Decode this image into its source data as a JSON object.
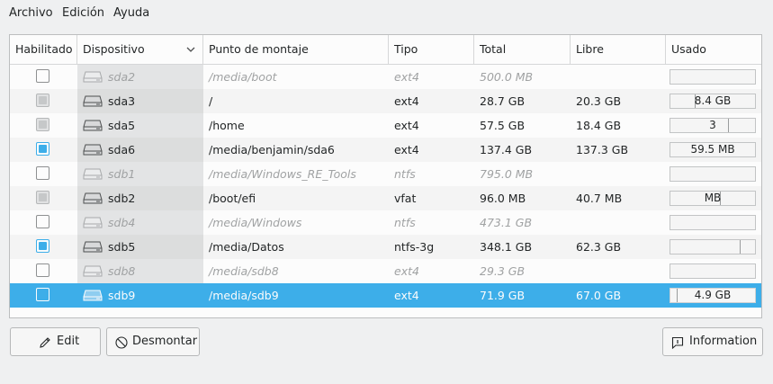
{
  "menu": {
    "archivo": "Archivo",
    "edicion": "Edición",
    "ayuda": "Ayuda"
  },
  "table": {
    "headers": {
      "habilitado": "Habilitado",
      "dispositivo": "Dispositivo",
      "punto": "Punto de montaje",
      "tipo": "Tipo",
      "total": "Total",
      "libre": "Libre",
      "usado": "Usado"
    },
    "rows": [
      {
        "device": "sda2",
        "mount": "/media/boot",
        "type": "ext4",
        "total": "500.0 MB",
        "free": "",
        "used": "",
        "used_fraction": 0,
        "enabled": "none",
        "mounted": false
      },
      {
        "device": "sda3",
        "mount": "/",
        "type": "ext4",
        "total": "28.7 GB",
        "free": "20.3 GB",
        "used": "8.4 GB",
        "used_fraction": 0.29,
        "enabled": "grey",
        "mounted": true
      },
      {
        "device": "sda5",
        "mount": "/home",
        "type": "ext4",
        "total": "57.5 GB",
        "free": "18.4 GB",
        "used": "3",
        "used_fraction": 0.68,
        "enabled": "grey",
        "mounted": true
      },
      {
        "device": "sda6",
        "mount": "/media/benjamin/sda6",
        "type": "ext4",
        "total": "137.4 GB",
        "free": "137.3 GB",
        "used": "59.5 MB",
        "used_fraction": 0.0,
        "enabled": "checked",
        "mounted": true
      },
      {
        "device": "sdb1",
        "mount": "/media/Windows_RE_Tools",
        "type": "ntfs",
        "total": "795.0 MB",
        "free": "",
        "used": "",
        "used_fraction": 0,
        "enabled": "none",
        "mounted": false
      },
      {
        "device": "sdb2",
        "mount": "/boot/efi",
        "type": "vfat",
        "total": "96.0 MB",
        "free": "40.7 MB",
        "used": "MB",
        "used_fraction": 0.58,
        "enabled": "grey",
        "mounted": true
      },
      {
        "device": "sdb4",
        "mount": "/media/Windows",
        "type": "ntfs",
        "total": "473.1 GB",
        "free": "",
        "used": "",
        "used_fraction": 0,
        "enabled": "none",
        "mounted": false
      },
      {
        "device": "sdb5",
        "mount": "/media/Datos",
        "type": "ntfs-3g",
        "total": "348.1 GB",
        "free": "62.3 GB",
        "used": "",
        "used_fraction": 0.82,
        "enabled": "checked",
        "mounted": true
      },
      {
        "device": "sdb8",
        "mount": "/media/sdb8",
        "type": "ext4",
        "total": "29.3 GB",
        "free": "",
        "used": "",
        "used_fraction": 0,
        "enabled": "none",
        "mounted": false
      },
      {
        "device": "sdb9",
        "mount": "/media/sdb9",
        "type": "ext4",
        "total": "71.9 GB",
        "free": "67.0 GB",
        "used": "4.9 GB",
        "used_fraction": 0.07,
        "enabled": "none",
        "mounted": true,
        "selected": true
      }
    ]
  },
  "buttons": {
    "edit": "Edit",
    "unmount": "Desmontar",
    "info": "Information"
  },
  "colors": {
    "accent": "#3daee9",
    "background": "#eff0f1"
  }
}
